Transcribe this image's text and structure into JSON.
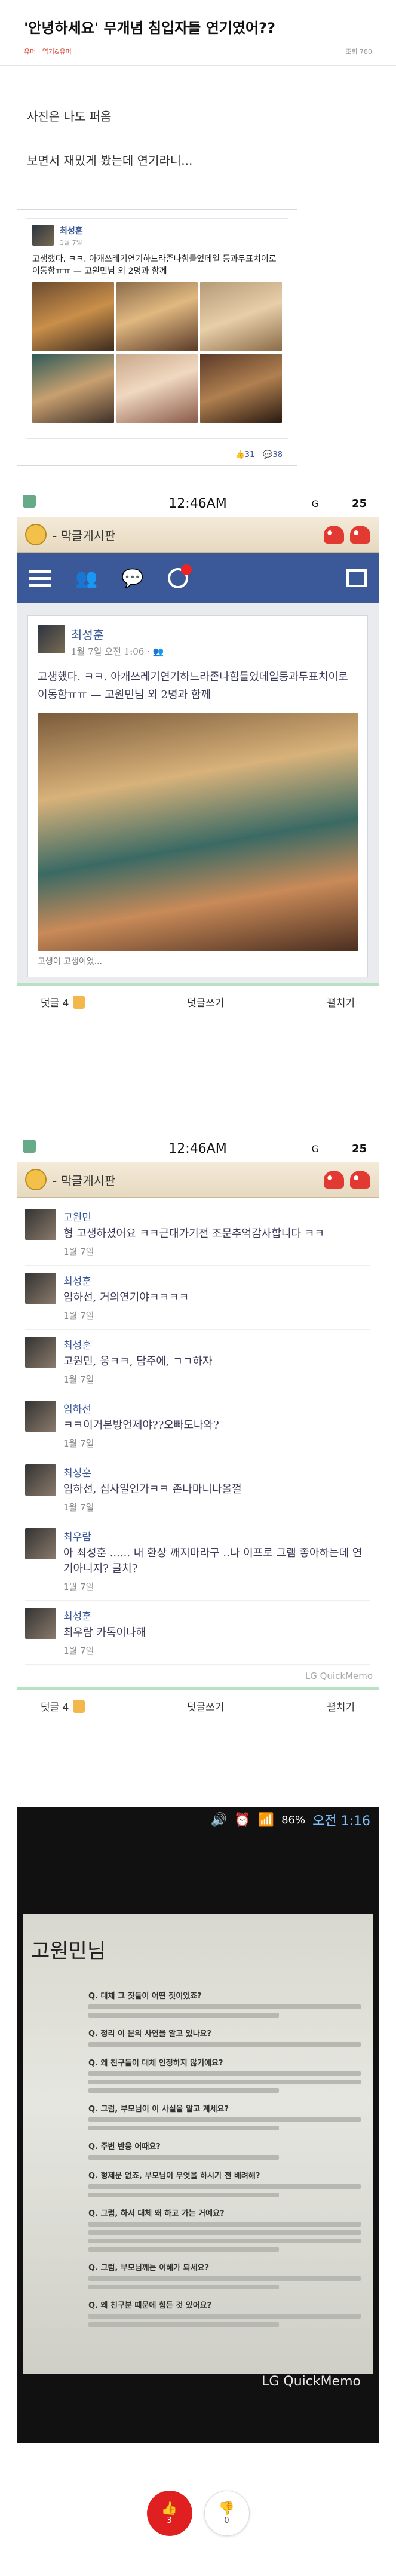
{
  "article": {
    "title": "'안녕하세요' 무개념 침입자들 연기였어??",
    "category": "유머 · 엽기&유머",
    "meta_info": "",
    "views": "조회 780",
    "body": [
      "사진은 나도 퍼옴",
      "보면서 재밌게 봤는데 연기라니..."
    ]
  },
  "fb_card": {
    "name": "최성훈",
    "time": "1월 7일",
    "text": "고생했다. ㅋㅋ. 아개쓰레기연기하느라존나힘들었데일 등과두표치이로이동함ㅠㅠ — 고원민님 외 2명과 함께",
    "likes": "31",
    "comments": "38"
  },
  "shot1": {
    "status_time": "12:46AM",
    "status_g": "G",
    "status_num": "25",
    "board_title": "- 막글게시판",
    "post_name": "최성훈",
    "post_time": "1월 7일 오전 1:06 · 👥",
    "post_text": "고생했다. ㅋㅋ. 아개쓰레기연기하느라존나힘들었데일등과두표치이로 이동함ㅠㅠ — 고원민님 외 2명과 함께",
    "cut_text": "고생이 고생이었...",
    "like_label": "덧글 4",
    "write_label": "덧글쓰기",
    "more_label": "펼치기"
  },
  "shot2": {
    "status_time": "12:46AM",
    "status_g": "G",
    "status_num": "25",
    "board_title": "- 막글게시판",
    "comments": [
      {
        "name": "고원민",
        "text": "형 고생하셨어요 ㅋㅋ근대가기전 조문추억감사합니다 ㅋㅋ",
        "date": "1월 7일"
      },
      {
        "name": "최성훈",
        "text": "임하선, 거의연기야ㅋㅋㅋㅋ",
        "date": "1월 7일"
      },
      {
        "name": "최성훈",
        "text": "고원민, 웅ㅋㅋ, 담주에, ㄱㄱ하자",
        "date": "1월 7일"
      },
      {
        "name": "임하선",
        "text": "ㅋㅋ이거본방언제야??오빠도나와?",
        "date": "1월 7일"
      },
      {
        "name": "최성훈",
        "text": "임하선, 십사일인가ㅋㅋ 존나마니나올껄",
        "date": "1월 7일"
      },
      {
        "name": "최우람",
        "text": "아 최성훈 ...... 내 환상 깨지마라구 ..나 이프로 그램 좋아하는데 연기아니지? 글치?",
        "date": "1월 7일"
      },
      {
        "name": "최성훈",
        "text": "최우람 카톡이나해",
        "date": "1월 7일"
      }
    ],
    "memo": "LG QuickMemo",
    "like_label": "덧글 4",
    "write_label": "덧글쓰기",
    "more_label": "펼치기"
  },
  "phone": {
    "battery": "86%",
    "clock": "오전 1:16",
    "doc_name": "고원민님",
    "questions": [
      "Q. 대체 그 짓들이 어떤 짓이었죠?",
      "Q. 정리 이 분의 사연을 알고 있나요?",
      "Q. 왜 친구들이 대체 인정하지 않기에요?",
      "Q. 그럼, 부모님이 이 사실을 알고 계세요?",
      "Q. 주변 반응 어때요?",
      "Q. 형제분 없죠, 부모님이 무엇을 하시기 전 배려해?",
      "Q. 그럼, 하서 대체 왜 하고 가는 거예요?",
      "Q. 그럼, 부모님께는 이해가 되세요?",
      "Q. 왜 친구분 때문에 힘든 것 있어요?"
    ],
    "memo": "LG QuickMemo"
  },
  "votes": {
    "up_count": "3",
    "down_count": "0"
  }
}
